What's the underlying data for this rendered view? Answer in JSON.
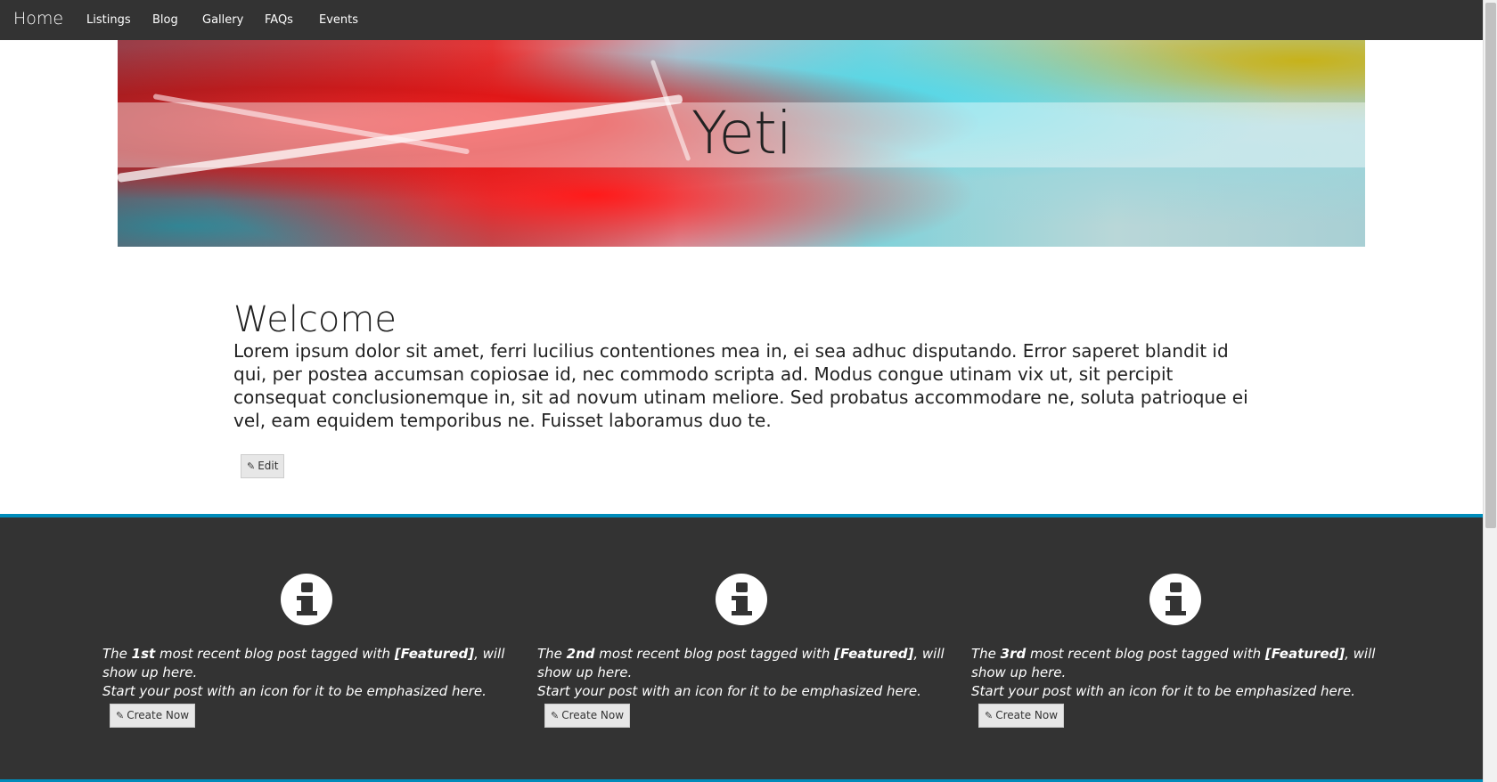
{
  "nav": {
    "brand": "Home",
    "links": [
      "Listings",
      "Blog",
      "Gallery",
      "FAQs",
      "Events"
    ]
  },
  "hero": {
    "title": "Yeti"
  },
  "welcome": {
    "title": "Welcome",
    "body": "Lorem ipsum dolor sit amet, ferri lucilius contentiones mea in, ei sea adhuc disputando. Error saperet blandit id qui, per postea accumsan copiosae id, nec commodo scripta ad. Modus congue utinam vix ut, sit percipit consequat conclusionemque in, sit ad novum utinam meliore. Sed probatus accommodare ne, soluta patrioque ei vel, eam equidem temporibus ne. Fuisset laboramus duo te.",
    "edit_label": "Edit"
  },
  "features": [
    {
      "prefix": "The ",
      "ordinal": "1st",
      "middle": " most recent blog post tagged with ",
      "tag": "[Featured]",
      "suffix": ", will show up here.",
      "line2": "Start your post with an icon for it to be emphasized here.",
      "button": "Create Now",
      "icon": "info-circle-icon"
    },
    {
      "prefix": "The ",
      "ordinal": "2nd",
      "middle": " most recent blog post tagged with ",
      "tag": "[Featured]",
      "suffix": ", will show up here.",
      "line2": "Start your post with an icon for it to be emphasized here.",
      "button": "Create Now",
      "icon": "info-circle-icon"
    },
    {
      "prefix": "The ",
      "ordinal": "3rd",
      "middle": " most recent blog post tagged with ",
      "tag": "[Featured]",
      "suffix": ", will show up here.",
      "line2": "Start your post with an icon for it to be emphasized here.",
      "button": "Create Now",
      "icon": "info-circle-icon"
    }
  ],
  "colors": {
    "navbar": "#333333",
    "accent": "#008cba",
    "dark_section": "#333333",
    "button_bg": "#e7e7e7"
  }
}
